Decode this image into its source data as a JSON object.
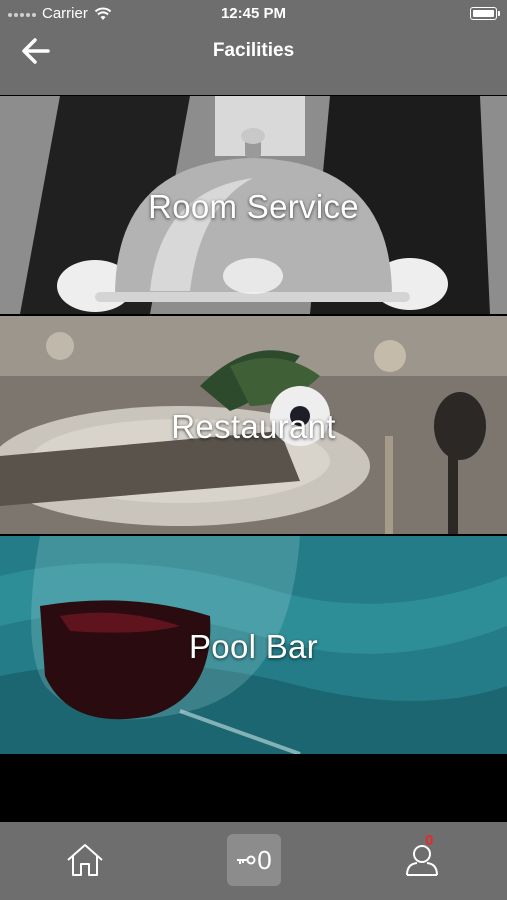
{
  "status_bar": {
    "carrier": "Carrier",
    "time": "12:45 PM"
  },
  "nav": {
    "title": "Facilities",
    "back_icon": "arrow-left-icon"
  },
  "tiles": [
    {
      "label": "Room Service",
      "image": "cloche-photo"
    },
    {
      "label": "Restaurant",
      "image": "table-setting-photo"
    },
    {
      "label": "Pool Bar",
      "image": "wine-glass-photo"
    }
  ],
  "tab_bar": {
    "home_icon": "home-icon",
    "key_count": "0",
    "profile_badge": "0"
  },
  "colors": {
    "bar": "#6e6e6e",
    "badge": "#e62a2a",
    "pool_accent": "#2a8f98"
  }
}
